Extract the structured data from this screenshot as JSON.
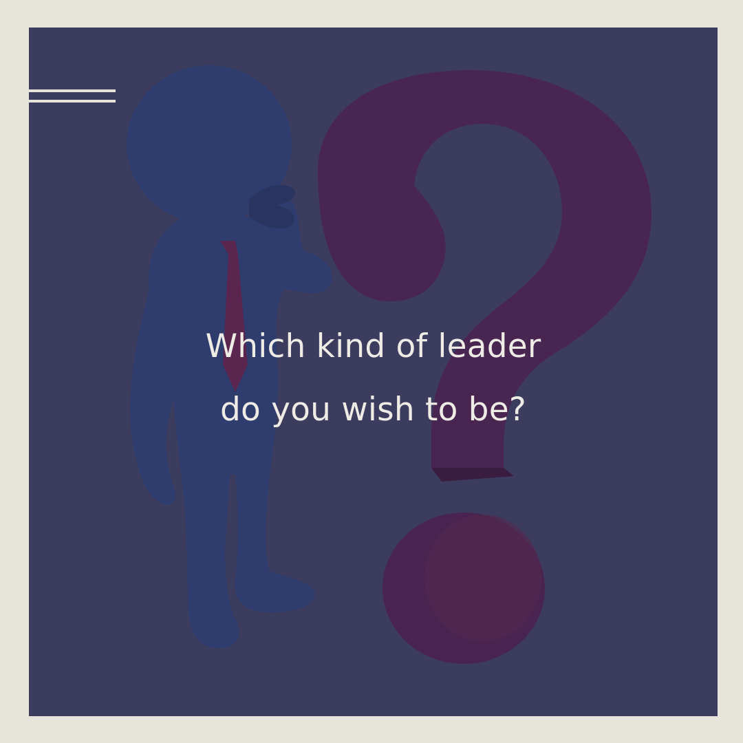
{
  "headline": {
    "line1": "Which kind of leader",
    "line2": "do you wish to be?"
  },
  "illustration": {
    "figure": "thinking-person-figure",
    "symbol": "question-mark",
    "colors": {
      "frame": "#e7e4dc",
      "panel": "#3c3c5e",
      "figure": "#2e3e6e",
      "tie": "#5a2650",
      "question_mark": "#4a2450",
      "text": "#efece6"
    }
  }
}
